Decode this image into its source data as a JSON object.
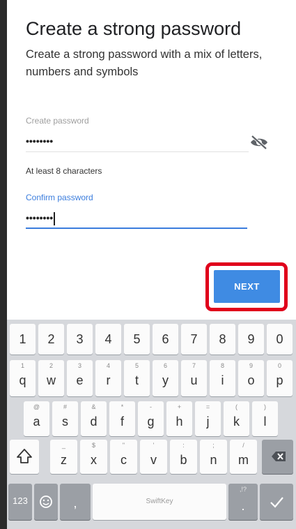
{
  "screen": {
    "title": "Create a strong password",
    "subtitle": "Create a strong password with a mix of letters, numbers and symbols",
    "create_password": {
      "label": "Create password",
      "value": "••••••••"
    },
    "toggle_icon": "eye-off-icon",
    "helper_text": "At least 8 characters",
    "confirm_password": {
      "label": "Confirm password",
      "value": "••••••••"
    },
    "next_label": "NEXT"
  },
  "keyboard": {
    "number_row": [
      "1",
      "2",
      "3",
      "4",
      "5",
      "6",
      "7",
      "8",
      "9",
      "0"
    ],
    "row1": [
      {
        "main": "q",
        "hint": "1"
      },
      {
        "main": "w",
        "hint": "2"
      },
      {
        "main": "e",
        "hint": "3"
      },
      {
        "main": "r",
        "hint": "4"
      },
      {
        "main": "t",
        "hint": "5"
      },
      {
        "main": "y",
        "hint": "6"
      },
      {
        "main": "u",
        "hint": "7"
      },
      {
        "main": "i",
        "hint": "8"
      },
      {
        "main": "o",
        "hint": "9"
      },
      {
        "main": "p",
        "hint": "0"
      }
    ],
    "row2": [
      {
        "main": "a",
        "hint": "@"
      },
      {
        "main": "s",
        "hint": "#"
      },
      {
        "main": "d",
        "hint": "&"
      },
      {
        "main": "f",
        "hint": "*"
      },
      {
        "main": "g",
        "hint": "-"
      },
      {
        "main": "h",
        "hint": "+"
      },
      {
        "main": "j",
        "hint": "="
      },
      {
        "main": "k",
        "hint": "("
      },
      {
        "main": "l",
        "hint": ")"
      }
    ],
    "row3": [
      {
        "main": "z",
        "hint": "_"
      },
      {
        "main": "x",
        "hint": "$"
      },
      {
        "main": "c",
        "hint": "\""
      },
      {
        "main": "v",
        "hint": "'"
      },
      {
        "main": "b",
        "hint": ":"
      },
      {
        "main": "n",
        "hint": ";"
      },
      {
        "main": "m",
        "hint": "/"
      }
    ],
    "numbers_key": "123",
    "emoji_icon": "smiley-icon",
    "comma": ",",
    "space_label": "SwiftKey",
    "period": ".",
    "period_hint": ",!?",
    "shift_icon": "shift-icon",
    "backspace_icon": "backspace-icon",
    "enter_icon": "checkmark-icon"
  },
  "colors": {
    "accent": "#3b7ddd",
    "next_button": "#3f8be3",
    "highlight": "#e0001b"
  }
}
